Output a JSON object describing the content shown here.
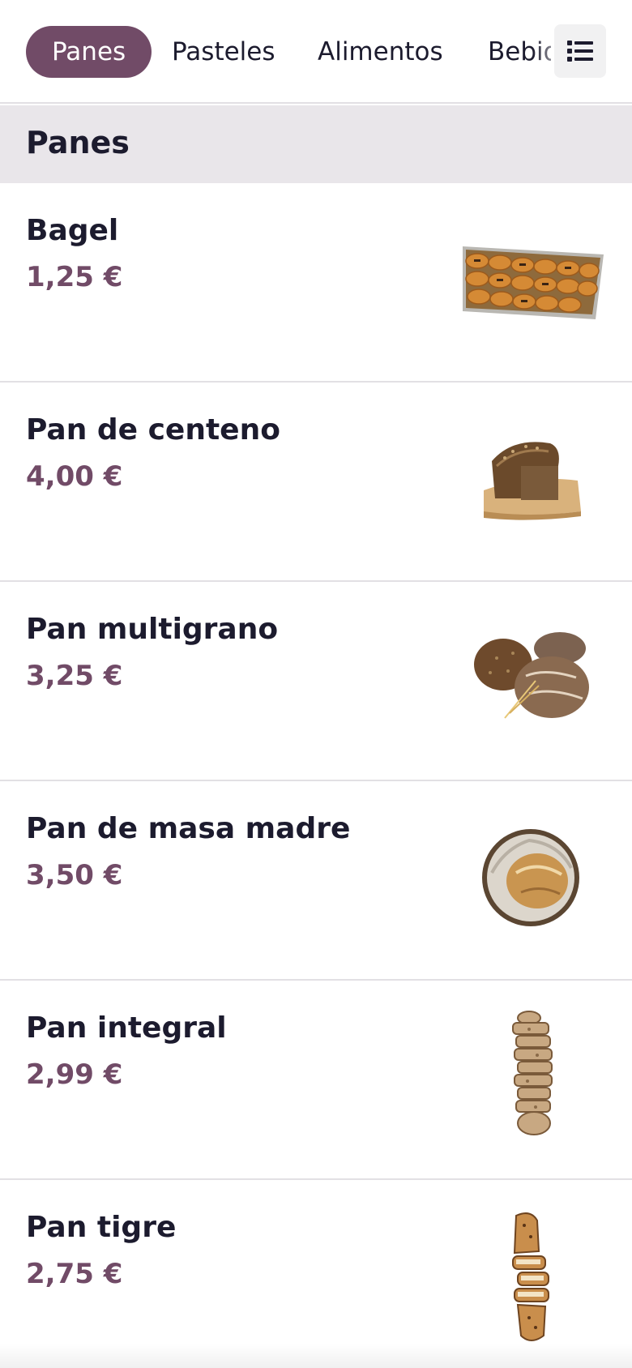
{
  "categories": {
    "tabs": [
      {
        "label": "Panes",
        "active": true
      },
      {
        "label": "Pasteles",
        "active": false
      },
      {
        "label": "Alimentos",
        "active": false
      },
      {
        "label": "Bebidas",
        "active": false
      }
    ],
    "toggle_icon": "list-icon"
  },
  "section": {
    "title": "Panes"
  },
  "products": [
    {
      "name": "Bagel",
      "price": "1,25 €",
      "image": "pastry-tray-image"
    },
    {
      "name": "Pan de centeno",
      "price": "4,00 €",
      "image": "rye-loaf-image"
    },
    {
      "name": "Pan multigrano",
      "price": "3,25 €",
      "image": "multigrain-loaves-image"
    },
    {
      "name": "Pan de masa madre",
      "price": "3,50 €",
      "image": "sourdough-basket-image"
    },
    {
      "name": "Pan integral",
      "price": "2,99 €",
      "image": "sliced-wholemeal-image"
    },
    {
      "name": "Pan tigre",
      "price": "2,75 €",
      "image": "tiger-bread-image"
    }
  ],
  "colors": {
    "accent": "#714b67",
    "header_bg": "#e9e6ea",
    "text": "#1c1b2e",
    "divider": "#e2e0e4"
  }
}
